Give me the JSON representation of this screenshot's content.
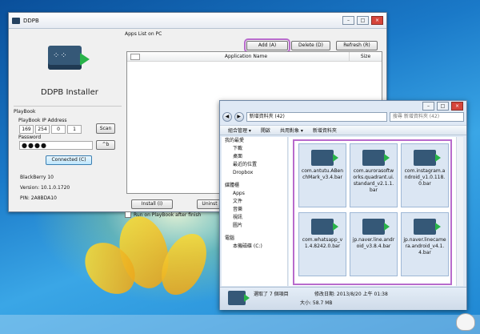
{
  "ddpb": {
    "title": "DDPB",
    "installer_title": "DDPB Installer",
    "playbook_label": "PlayBook",
    "ip_label": "PlayBook IP Address",
    "ip": [
      "169",
      "254",
      "0",
      "1"
    ],
    "scan_button": "Scan",
    "password_label": "Password",
    "password_value": "●●●●",
    "reveal_button": "^b",
    "connected_button": "Connected (C)",
    "device": "BlackBerry 10",
    "version": "Version: 10.1.0.1720",
    "pin": "PIN: 2A8BDA10",
    "apps_list_label": "Apps List on PC",
    "add_button": "Add (A)",
    "delete_button": "Delete (D)",
    "refresh_button": "Refresh (R)",
    "col_name": "Application Name",
    "col_size": "Size",
    "install_button": "Install (I)",
    "uninstall_button": "Uninst",
    "run_label": "Run on PlayBook after finish",
    "highlight_color": "#b86bcc"
  },
  "explorer": {
    "path": "新增資料夾 (42)",
    "search_placeholder": "搜尋 新增資料夾 (42)",
    "cmd_organize": "組合管理 ▾",
    "cmd_open": "開啟",
    "cmd_share": "共用對象 ▾",
    "cmd_newfolder": "新增資料夾",
    "nav": [
      "我的最愛",
      "下載",
      "桌面",
      "最近的位置",
      "Dropbox",
      "媒體櫃",
      "Apps",
      "文件",
      "音樂",
      "視訊",
      "圖片",
      "電腦",
      "本機磁碟 (C:)"
    ],
    "files": [
      "com.antutu.ABenchMark_v3.4.bar",
      "com.aurorasoftworks.quadrant.ui.standard_v2.1.1.bar",
      "com.instagram.android_v1.0.118.0.bar",
      "com.whatsapp_v1.4.8242.0.bar",
      "jp.naver.line.android_v3.8.4.bar",
      "jp.naver.linecamera.android_v4.1.4.bar"
    ],
    "status_selected": "選取了 7 個項目",
    "status_date": "修改日期: 2013/8/20 上午 01:38",
    "status_size": "大小: 58.7 MB"
  }
}
